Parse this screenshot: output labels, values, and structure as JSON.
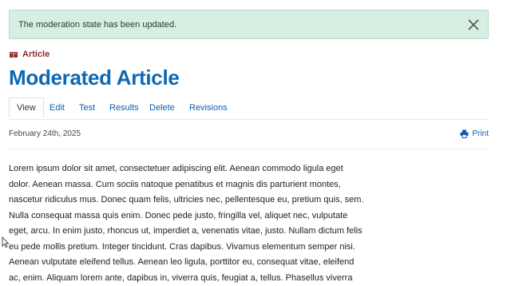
{
  "alert": {
    "message": "The moderation state has been updated."
  },
  "content_type": {
    "label": "Article",
    "icon": "book-icon"
  },
  "page_title": "Moderated Article",
  "tabs": [
    {
      "label": "View"
    },
    {
      "label": "Edit"
    },
    {
      "label": "Test"
    },
    {
      "label": "Results"
    },
    {
      "label": "Delete"
    },
    {
      "label": "Revisions"
    }
  ],
  "date": "February 24th, 2025",
  "print_label": "Print",
  "body_lines": [
    "Lorem ipsum dolor sit amet, consectetuer adipiscing elit. Aenean commodo ligula eget",
    "dolor. Aenean massa. Cum sociis natoque penatibus et magnis dis parturient montes,",
    "nascetur ridiculus mus. Donec quam felis, ultricies nec, pellentesque eu, pretium quis, sem.",
    "Nulla consequat massa quis enim. Donec pede justo, fringilla vel, aliquet nec, vulputate",
    "eget, arcu. In enim justo, rhoncus ut, imperdiet a, venenatis vitae, justo. Nullam dictum felis",
    "eu pede mollis pretium. Integer tincidunt. Cras dapibus. Vivamus elementum semper nisi.",
    "Aenean vulputate eleifend tellus. Aenean leo ligula, porttitor eu, consequat vitae, eleifend",
    "ac, enim. Aliquam lorem ante, dapibus in, viverra quis, feugiat a, tellus. Phasellus viverra"
  ],
  "colors": {
    "alert_bg": "#d7efe2",
    "title": "#0a68b5",
    "link": "#0b5fb0",
    "type_label": "#8a2c2c"
  }
}
